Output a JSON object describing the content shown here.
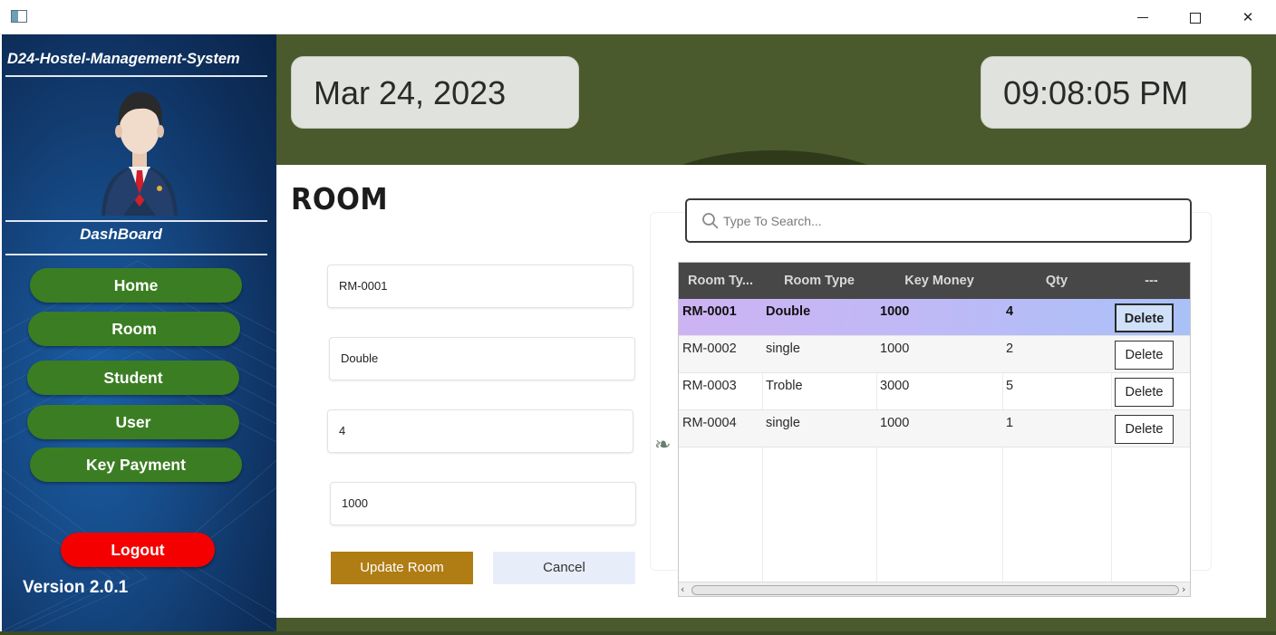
{
  "window": {
    "controls": {
      "minimize": "minimize",
      "maximize": "maximize",
      "close": "✕"
    }
  },
  "sidebar": {
    "brand": "D24-Hostel-Management-System",
    "section_title": "DashBoard",
    "nav": [
      {
        "label": "Home"
      },
      {
        "label": "Room"
      },
      {
        "label": "Student"
      },
      {
        "label": "User"
      },
      {
        "label": "Key Payment"
      }
    ],
    "logout_label": "Logout",
    "version": "Version 2.0.1"
  },
  "header": {
    "date": "Mar 24, 2023",
    "time": "09:08:05 PM"
  },
  "main": {
    "title": "ROOM",
    "form": {
      "room_id": "RM-0001",
      "room_type": "Double",
      "qty": "4",
      "key_money": "1000"
    },
    "update_label": "Update Room",
    "cancel_label": "Cancel",
    "search": {
      "placeholder": "Type To Search..."
    },
    "table": {
      "columns": [
        "Room Ty...",
        "Room Type",
        "Key Money",
        "Qty",
        "---"
      ],
      "rows": [
        {
          "id": "RM-0001",
          "type": "Double",
          "key_money": "1000",
          "qty": "4",
          "action": "Delete",
          "selected": true
        },
        {
          "id": "RM-0002",
          "type": "single",
          "key_money": "1000",
          "qty": "2",
          "action": "Delete"
        },
        {
          "id": "RM-0003",
          "type": "Troble",
          "key_money": "3000",
          "qty": "5",
          "action": "Delete"
        },
        {
          "id": "RM-0004",
          "type": "single",
          "key_money": "1000",
          "qty": "1",
          "action": "Delete"
        }
      ]
    }
  },
  "colors": {
    "sidebar_bg": "#164a86",
    "nav_button": "#3b7d23",
    "logout_button": "#f40000",
    "header_bg": "#4a5a2c",
    "update_button": "#b07c14",
    "cancel_button": "#e8eef9",
    "table_header": "#474747",
    "selected_row": "#c0b9f6"
  },
  "icons": {
    "app": "app-window-icon",
    "avatar": "businessman-avatar-icon",
    "search": "search-icon"
  }
}
